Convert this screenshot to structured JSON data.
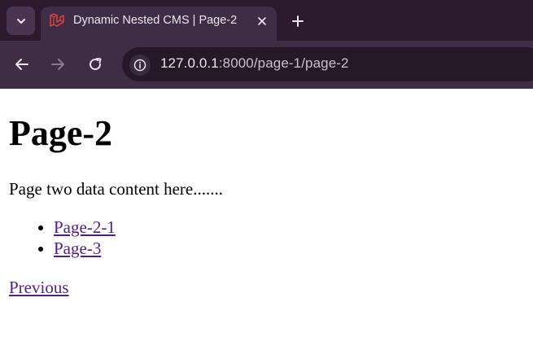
{
  "browser": {
    "tab": {
      "title": "Dynamic Nested CMS | Page-2"
    },
    "new_tab_label": "+",
    "url_host": "127.0.0.1",
    "url_path": ":8000/page-1/page-2"
  },
  "page": {
    "heading": "Page-2",
    "content": "Page two data content here.......",
    "links": [
      {
        "label": "Page-2-1"
      },
      {
        "label": "Page-3"
      }
    ],
    "previous_label": "Previous"
  },
  "colors": {
    "tabbar": "#2b1a2e",
    "toolbar": "#3f2c45",
    "link": "#551a8b",
    "favicon": "#e0443a"
  },
  "icons": [
    "tab-list-icon",
    "laravel-icon",
    "close-icon",
    "plus-icon",
    "back-arrow-icon",
    "forward-arrow-icon",
    "reload-icon",
    "info-icon"
  ]
}
